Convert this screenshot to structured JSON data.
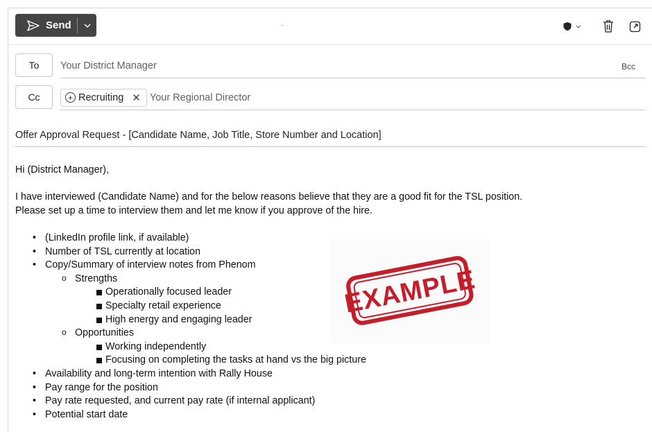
{
  "toolbar": {
    "send_label": "Send"
  },
  "fields": {
    "to_label": "To",
    "to_placeholder": "Your District Manager",
    "bcc_label": "Bcc",
    "cc_label": "Cc",
    "cc_chip": "Recruiting",
    "cc_placeholder": "Your Regional Director",
    "subject": "Offer Approval Request - [Candidate Name, Job Title, Store Number and Location]"
  },
  "body": {
    "greeting": "Hi (District Manager),",
    "para_line1": "I have interviewed (Candidate Name) and for the below reasons believe that they are a good fit for the TSL position.",
    "para_line2": "Please set up a time to interview them and let me know if you approve of the hire.",
    "bullets": [
      "(LinkedIn profile link, if available)",
      "Number of TSL currently at location",
      "Copy/Summary of interview notes from Phenom"
    ],
    "strengths_label": "Strengths",
    "strengths": [
      "Operationally focused leader",
      "Specialty retail experience",
      "High energy and engaging leader"
    ],
    "opportunities_label": "Opportunities",
    "opportunities": [
      "Working independently",
      "Focusing on completing the tasks at hand vs the big picture"
    ],
    "bullets_after": [
      "Availability and long-term intention with Rally House",
      "Pay range for the position",
      "Pay rate requested, and current pay rate (if internal applicant)",
      "Potential start date"
    ]
  },
  "stamp": {
    "text": "EXAMPLE",
    "color": "#c41e2a"
  },
  "icons": {
    "send": "send-icon",
    "dropdown": "chevron-down-icon",
    "sensitivity": "shield-icon",
    "discard": "trash-icon",
    "popout": "pop-out-icon",
    "chip": "group-add-icon",
    "chip_remove": "close-icon"
  }
}
